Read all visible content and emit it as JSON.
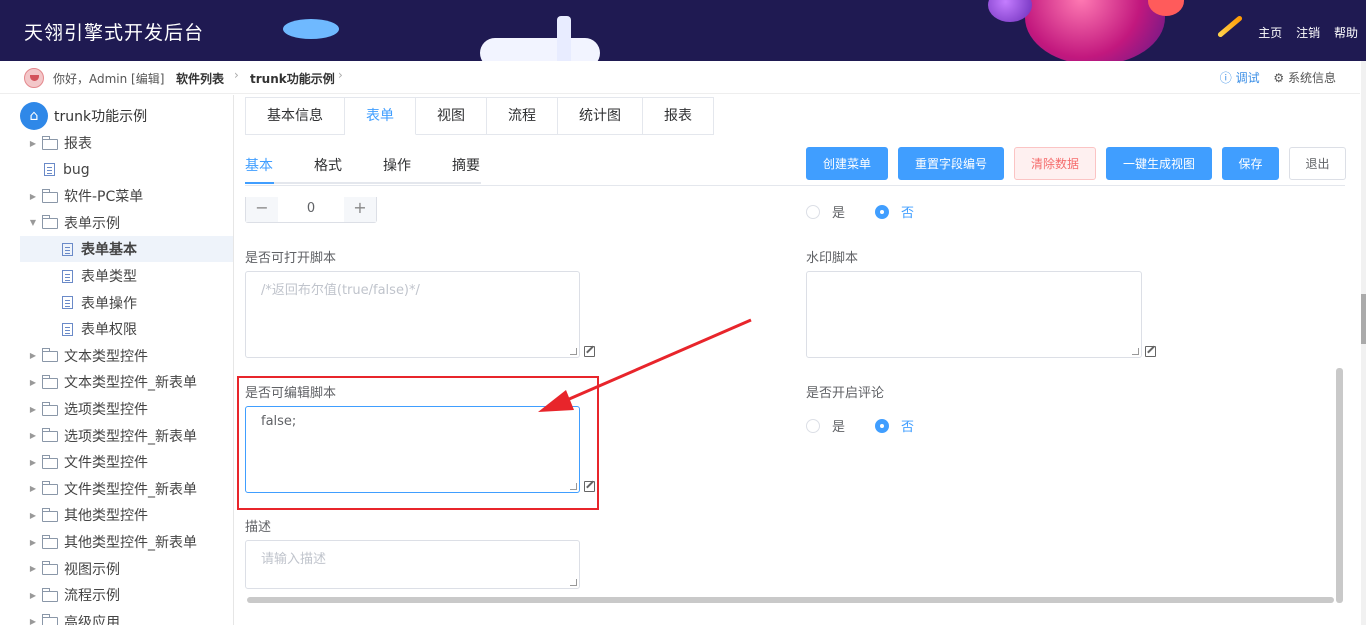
{
  "header": {
    "title": "天翎引擎式开发后台",
    "links": [
      "主页",
      "注销",
      "帮助"
    ]
  },
  "crumbbar": {
    "greeting": "你好，Admin [编辑]",
    "crumbs": [
      "软件列表",
      "trunk功能示例"
    ],
    "debug": "ⓘ 调试",
    "sysinfo": "⚙ 系统信息"
  },
  "sidebar": {
    "root": "trunk功能示例",
    "items": [
      {
        "label": "报表",
        "type": "folder",
        "arrow": "▶"
      },
      {
        "label": "bug",
        "type": "file",
        "arrow": ""
      },
      {
        "label": "软件-PC菜单",
        "type": "folder",
        "arrow": "▶"
      },
      {
        "label": "表单示例",
        "type": "folder-open",
        "arrow": "▼"
      },
      {
        "label": "表单基本",
        "type": "file",
        "arrow": "",
        "active": true,
        "child": true
      },
      {
        "label": "表单类型",
        "type": "file",
        "arrow": "",
        "child": true
      },
      {
        "label": "表单操作",
        "type": "file",
        "arrow": "",
        "child": true
      },
      {
        "label": "表单权限",
        "type": "file",
        "arrow": "",
        "child": true
      },
      {
        "label": "文本类型控件",
        "type": "folder",
        "arrow": "▶"
      },
      {
        "label": "文本类型控件_新表单",
        "type": "folder",
        "arrow": "▶"
      },
      {
        "label": "选项类型控件",
        "type": "folder",
        "arrow": "▶"
      },
      {
        "label": "选项类型控件_新表单",
        "type": "folder",
        "arrow": "▶"
      },
      {
        "label": "文件类型控件",
        "type": "folder",
        "arrow": "▶"
      },
      {
        "label": "文件类型控件_新表单",
        "type": "folder",
        "arrow": "▶"
      },
      {
        "label": "其他类型控件",
        "type": "folder",
        "arrow": "▶"
      },
      {
        "label": "其他类型控件_新表单",
        "type": "folder",
        "arrow": "▶"
      },
      {
        "label": "视图示例",
        "type": "folder",
        "arrow": "▶"
      },
      {
        "label": "流程示例",
        "type": "folder",
        "arrow": "▶"
      },
      {
        "label": "高级应用",
        "type": "folder",
        "arrow": "▶"
      }
    ]
  },
  "tabs": [
    "基本信息",
    "表单",
    "视图",
    "流程",
    "统计图",
    "报表"
  ],
  "active_tab": 1,
  "subtabs": [
    "基本",
    "格式",
    "操作",
    "摘要"
  ],
  "toolbar": {
    "create_menu": "创建菜单",
    "reset_fields": "重置字段编号",
    "clear_data": "清除数据",
    "gen_view": "一键生成视图",
    "save": "保存",
    "exit": "退出"
  },
  "form": {
    "stepper": {
      "minus": "−",
      "value": "0",
      "plus": "+"
    },
    "radio_yes": "是",
    "radio_no": "否",
    "open_script_label": "是否可打开脚本",
    "open_script_placeholder": "/*返回布尔值(true/false)*/",
    "watermark_label": "水印脚本",
    "edit_script_label": "是否可编辑脚本",
    "edit_script_value": "false;",
    "comment_label": "是否开启评论",
    "desc_label": "描述",
    "desc_placeholder": "请输入描述"
  },
  "colors": {
    "header_bg": "#1f1a52",
    "accent": "#409eff",
    "highlight": "#e8252b"
  }
}
